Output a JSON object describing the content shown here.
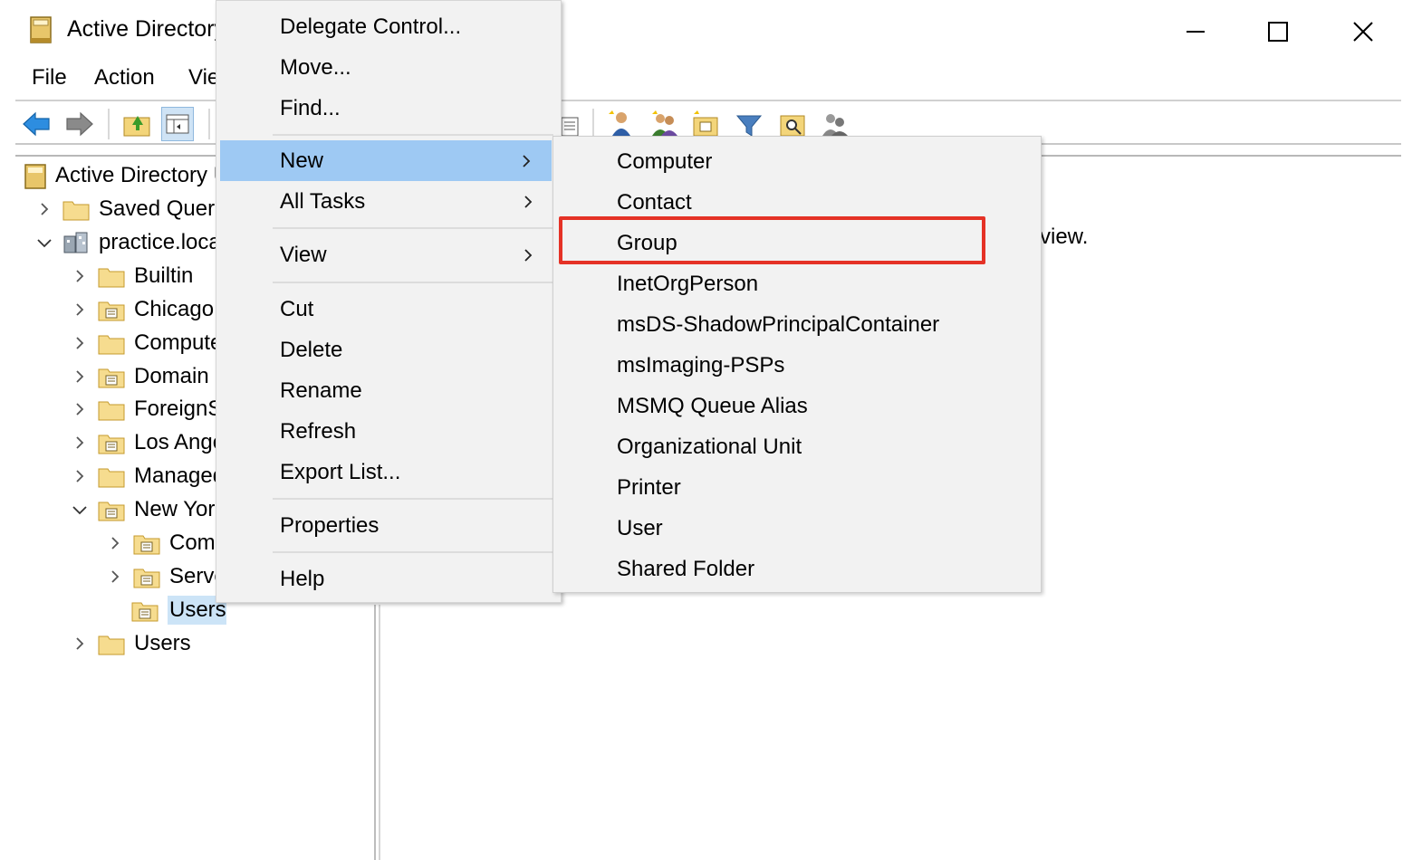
{
  "window": {
    "title": "Active Directory Users and Computers",
    "minimize_icon": "minimize-icon",
    "maximize_icon": "maximize-icon",
    "close_icon": "close-icon"
  },
  "menubar": {
    "file": "File",
    "action": "Action",
    "view": "View"
  },
  "toolbar": {
    "icons": [
      "back-arrow-icon",
      "forward-arrow-icon",
      "up-folder-icon",
      "show-hide-console-tree-icon",
      "list-icon",
      "create-user-icon",
      "create-group-icon",
      "create-ou-icon",
      "filter-icon",
      "find-icon",
      "add-to-group-icon"
    ]
  },
  "tree": {
    "root": "Active Directory Users and Computers",
    "items": [
      {
        "label": "Saved Queries",
        "level": 1,
        "expander": "collapsed"
      },
      {
        "label": "practice.local",
        "level": 1,
        "expander": "expanded"
      },
      {
        "label": "Builtin",
        "level": 2,
        "expander": "collapsed"
      },
      {
        "label": "Chicago",
        "level": 2,
        "expander": "collapsed"
      },
      {
        "label": "Computers",
        "level": 2,
        "expander": "collapsed"
      },
      {
        "label": "Domain Controllers",
        "level": 2,
        "expander": "collapsed"
      },
      {
        "label": "ForeignSecurityPrincipals",
        "level": 2,
        "expander": "collapsed"
      },
      {
        "label": "Los Angeles",
        "level": 2,
        "expander": "collapsed"
      },
      {
        "label": "Managed Service Accounts",
        "level": 2,
        "expander": "collapsed"
      },
      {
        "label": "New York",
        "level": 2,
        "expander": "expanded"
      },
      {
        "label": "Computers",
        "level": 3,
        "expander": "collapsed"
      },
      {
        "label": "Servers",
        "level": 3,
        "expander": "collapsed"
      },
      {
        "label": "Users",
        "level": 3,
        "expander": "none",
        "selected": true
      },
      {
        "label": "Users",
        "level": 2,
        "expander": "collapsed"
      }
    ]
  },
  "context_menu": {
    "items": [
      {
        "label": "Delegate Control..."
      },
      {
        "label": "Move..."
      },
      {
        "label": "Find..."
      },
      {
        "label": "New",
        "submenu": true,
        "active": true
      },
      {
        "label": "All Tasks",
        "submenu": true
      },
      {
        "label": "View",
        "submenu": true
      },
      {
        "label": "Cut"
      },
      {
        "label": "Delete"
      },
      {
        "label": "Rename"
      },
      {
        "label": "Refresh"
      },
      {
        "label": "Export List..."
      },
      {
        "label": "Properties"
      },
      {
        "label": "Help"
      }
    ]
  },
  "submenu_new": {
    "items": [
      "Computer",
      "Contact",
      "Group",
      "InetOrgPerson",
      "msDS-ShadowPrincipalContainer",
      "msImaging-PSPs",
      "MSMQ Queue Alias",
      "Organizational Unit",
      "Printer",
      "User",
      "Shared Folder"
    ],
    "highlighted": "Group"
  },
  "details_pane": {
    "partial_text": "view."
  },
  "colors": {
    "menu_bg": "#f2f2f2",
    "active_item": "#9ec9f3",
    "highlight_box": "#e53226",
    "selected_tree": "#cce4f7"
  }
}
